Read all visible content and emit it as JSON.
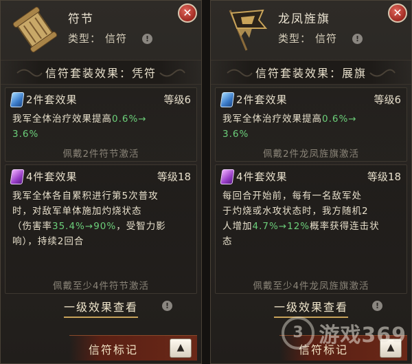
{
  "left": {
    "name": "符节",
    "type_label": "类型：",
    "type_value": "信符",
    "set_title": "信符套装效果：凭符",
    "set2": {
      "head": "2件套效果",
      "level": "等级6",
      "desc_pre": "我军全体治疗效果提高",
      "desc_hl": "0.6%→",
      "desc_hl2": "3.6%",
      "note": "佩戴2件符节激活"
    },
    "set4": {
      "head": "4件套效果",
      "level": "等级18",
      "line1": "我军全体各自累积进行第5次普攻",
      "line2": "时，对敌军单体施加灼烧状态",
      "line3_pre": "（伤害率",
      "line3_hl": "35.4%→90%",
      "line3_post": "，受智力影",
      "line4": "响），持续2回合",
      "note": "佩戴至少4件符节激活"
    },
    "level_effect_btn": "一级效果查看",
    "mark_label": "信符标记",
    "up_symbol": "▲",
    "close_symbol": "✕",
    "info_symbol": "!"
  },
  "right": {
    "name": "龙凤旌旗",
    "type_label": "类型：",
    "type_value": "信符",
    "set_title": "信符套装效果：展旗",
    "set2": {
      "head": "2件套效果",
      "level": "等级6",
      "desc_pre": "我军全体治疗效果提高",
      "desc_hl": "0.6%→",
      "desc_hl2": "3.6%",
      "note": "佩戴2件龙凤旌旗激活"
    },
    "set4": {
      "head": "4件套效果",
      "level": "等级18",
      "line1": "每回合开始前，每有一名敌军处",
      "line2": "于灼烧或水攻状态时，我方随机2",
      "line3_pre": "人增加",
      "line3_hl": "4.7%→12%",
      "line3_post": "概率获得连击状",
      "line4": "态",
      "note": "佩戴至少4件龙凤旌旗激活"
    },
    "level_effect_btn": "一级效果查看",
    "mark_label": "信符标记",
    "up_symbol": "▲",
    "close_symbol": "✕",
    "info_symbol": "!"
  },
  "watermark": {
    "text": "游戏369",
    "logo": "3"
  },
  "icons": [
    "scroll-tally-icon",
    "dragon-phoenix-flag-icon",
    "close-icon",
    "info-icon",
    "blue-gem-icon",
    "purple-gem-icon",
    "up-arrow-icon"
  ],
  "colors": {
    "highlight": "#6ccf7a",
    "close": "#b0302a",
    "accent_gold": "#c9a45a",
    "note": "#8a8478"
  }
}
